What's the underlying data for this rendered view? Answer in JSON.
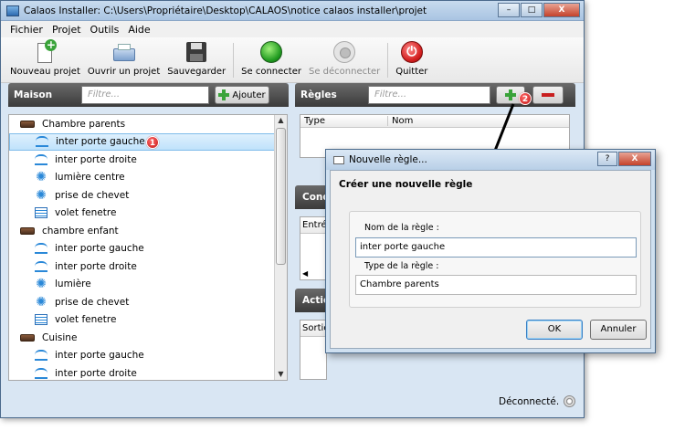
{
  "window": {
    "title": "Calaos Installer: C:\\Users\\Propriétaire\\Desktop\\CALAOS\\notice calaos installer\\projet",
    "controls": [
      "–",
      "□",
      "X"
    ]
  },
  "menu": [
    "Fichier",
    "Projet",
    "Outils",
    "Aide"
  ],
  "toolbar": {
    "new": "Nouveau projet",
    "open": "Ouvrir un projet",
    "save": "Sauvegarder",
    "connect": "Se connecter",
    "disconnect": "Se déconnecter",
    "quit": "Quitter"
  },
  "maison": {
    "title": "Maison",
    "filter_placeholder": "Filtre...",
    "add_label": "Ajouter",
    "rooms": [
      {
        "name": "Chambre parents",
        "items": [
          {
            "label": "inter porte gauche",
            "icon": "switch-icon",
            "selected": true
          },
          {
            "label": "inter porte droite",
            "icon": "switch-icon"
          },
          {
            "label": "lumière centre",
            "icon": "light-icon"
          },
          {
            "label": "prise de chevet",
            "icon": "light-icon"
          },
          {
            "label": "volet fenetre",
            "icon": "shutter-icon"
          }
        ]
      },
      {
        "name": "chambre enfant",
        "items": [
          {
            "label": "inter porte gauche",
            "icon": "switch-icon"
          },
          {
            "label": "inter porte droite",
            "icon": "switch-icon"
          },
          {
            "label": "lumière",
            "icon": "light-icon"
          },
          {
            "label": "prise de chevet",
            "icon": "light-icon"
          },
          {
            "label": "volet fenetre",
            "icon": "shutter-icon"
          }
        ]
      },
      {
        "name": "Cuisine",
        "items": [
          {
            "label": "inter porte gauche",
            "icon": "switch-icon"
          },
          {
            "label": "inter porte droite",
            "icon": "switch-icon"
          }
        ]
      }
    ]
  },
  "regles": {
    "title": "Règles",
    "filter_placeholder": "Filtre...",
    "columns": [
      "Type",
      "Nom"
    ]
  },
  "conditions": {
    "title": "Condi",
    "column": "Entrée"
  },
  "actions": {
    "title": "Actio",
    "column": "Sortie"
  },
  "annotations": {
    "badge1": "1",
    "badge2": "2"
  },
  "status": {
    "text": "Déconnecté."
  },
  "dialog": {
    "title": "Nouvelle règle...",
    "heading": "Créer une nouvelle règle",
    "name_label": "Nom de la règle :",
    "name_value": "inter porte gauche",
    "type_label": "Type de la règle :",
    "type_value": "Chambre parents",
    "ok": "OK",
    "cancel": "Annuler",
    "help": "?",
    "close": "X"
  }
}
